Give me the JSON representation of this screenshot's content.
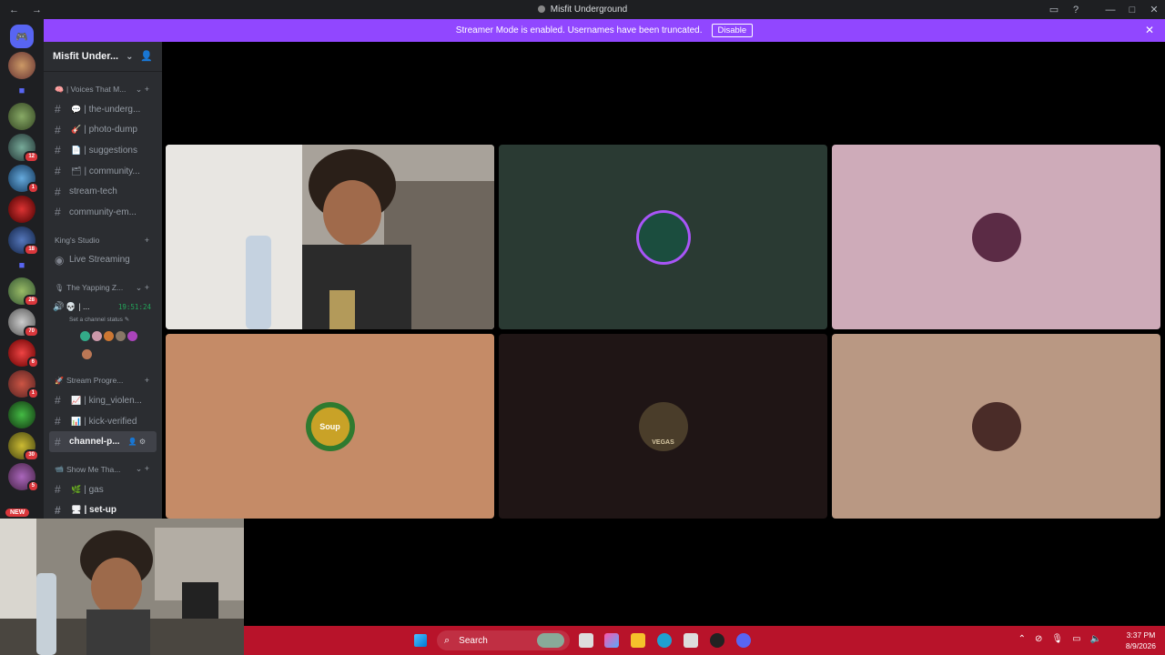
{
  "window": {
    "title": "Misfit Underground",
    "back_glyph": "←",
    "forward_glyph": "→",
    "controls": [
      "▭",
      "?",
      "—",
      "□",
      "✕"
    ]
  },
  "banner": {
    "text": "Streamer Mode is enabled. Usernames have been truncated.",
    "button": "Disable",
    "close": "✕"
  },
  "server_rail": {
    "badges": [
      "12",
      "1",
      "18",
      "28",
      "70",
      "6",
      "1",
      "30",
      "5"
    ],
    "new_tag": "NEW"
  },
  "sidebar": {
    "server_name": "Misfit Under...",
    "categories": [
      {
        "label": "| Voices That M...",
        "emoji": "🧠",
        "channels": [
          {
            "emoji": "💬",
            "name": "| the-underg..."
          },
          {
            "emoji": "🎸",
            "name": "| photo-dump"
          },
          {
            "emoji": "📄",
            "name": "| suggestions"
          },
          {
            "emoji": "🗂",
            "name": "| community..."
          },
          {
            "emoji": "",
            "name": "stream-tech"
          },
          {
            "emoji": "",
            "name": "community-em..."
          }
        ]
      },
      {
        "label": "King's Studio",
        "emoji": "",
        "live": "Live Streaming"
      },
      {
        "label": "The Yapping Z...",
        "emoji": "🎙",
        "voice_name": "| ...",
        "voice_emoji": "💀",
        "timer": "19:51:24",
        "status": "Set a channel status ✎"
      },
      {
        "label": "Stream Progre...",
        "emoji": "🚀",
        "channels": [
          {
            "emoji": "📈",
            "name": "| king_violen..."
          },
          {
            "emoji": "📊",
            "name": "| kick-verified"
          },
          {
            "emoji": "",
            "name": "channel-p..."
          }
        ]
      },
      {
        "label": "Show Me Tha...",
        "emoji": "📹",
        "channels": [
          {
            "emoji": "🌿",
            "name": "| gas"
          },
          {
            "emoji": "🖥",
            "name": "| set-up"
          }
        ]
      }
    ]
  },
  "tiles": [
    {
      "kind": "camera",
      "bg": "#3c3a36"
    },
    {
      "kind": "avatar",
      "bg": "#2a3a33",
      "label": "",
      "avatar_bg": "#1b4d3e",
      "ring": "#a855f7"
    },
    {
      "kind": "avatar",
      "bg": "#ceabb9",
      "label": "",
      "avatar_bg": "#5b2b45",
      "ring": ""
    },
    {
      "kind": "avatar",
      "bg": "#c58b67",
      "label": "Soup",
      "avatar_bg": "#c9a227",
      "ring": ""
    },
    {
      "kind": "avatar",
      "bg": "#1f1515",
      "label": "VEGAS",
      "avatar_bg": "#4a3d2a",
      "ring": ""
    },
    {
      "kind": "avatar",
      "bg": "#b99883",
      "label": "",
      "avatar_bg": "#4a2c28",
      "ring": ""
    }
  ],
  "taskbar": {
    "search": "Search",
    "time": "3:37 PM",
    "date": "8/9/2026"
  },
  "colors": {
    "accent": "#9147ff",
    "taskbar": "#b8132a",
    "voice_green": "#23a55a"
  }
}
